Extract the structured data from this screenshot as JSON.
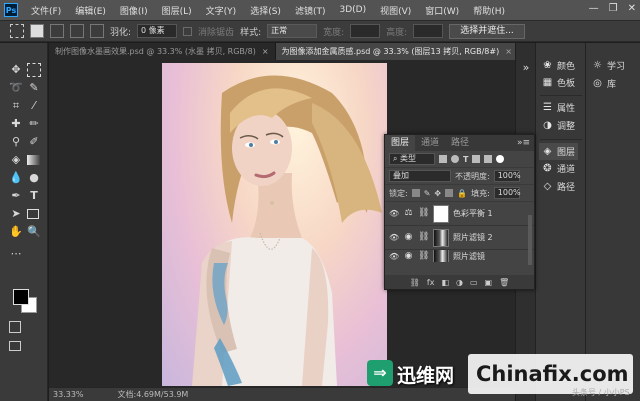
{
  "menubar": {
    "logo": "Ps",
    "items": [
      "文件(F)",
      "编辑(E)",
      "图像(I)",
      "图层(L)",
      "文字(Y)",
      "选择(S)",
      "滤镜(T)",
      "3D(D)",
      "视图(V)",
      "窗口(W)",
      "帮助(H)"
    ],
    "window_controls": [
      "—",
      "❐",
      "✕"
    ]
  },
  "options": {
    "feather_label": "羽化:",
    "feather_value": "0 像素",
    "antialias_label": "消除锯齿",
    "style_label": "样式:",
    "style_value": "正常",
    "width_label": "宽度:",
    "height_label": "高度:",
    "select_mask_button": "选择并遮住..."
  },
  "tabs": [
    {
      "label": "制作图像水墨画效果.psd @ 33.3% (水墨 拷贝, RGB/8)",
      "active": false
    },
    {
      "label": "为图像添加金属质感.psd @ 33.3% (图层13 拷贝, RGB/8#)",
      "active": true
    }
  ],
  "status": {
    "zoom": "33.33%",
    "doc": "文档:4.69M/53.9M"
  },
  "dock1": {
    "items": [
      "颜色",
      "色板",
      "属性",
      "调整",
      "图层",
      "通道",
      "路径"
    ]
  },
  "dock2": {
    "items": [
      "学习",
      "库"
    ]
  },
  "layers_panel": {
    "tabs": [
      "图层",
      "通道",
      "路径"
    ],
    "filter_label": "类型",
    "blend_mode": "叠加",
    "opacity_label": "不透明度:",
    "opacity_value": "100%",
    "lock_label": "锁定:",
    "fill_label": "填充:",
    "fill_value": "100%",
    "layers": [
      {
        "name": "色彩平衡 1"
      },
      {
        "name": "照片滤镜 2"
      },
      {
        "name": "照片滤镜"
      }
    ],
    "footer_icons": [
      "⛓",
      "fx",
      "◧",
      "◑",
      "▭",
      "▣",
      "🗑"
    ]
  },
  "watermarks": {
    "badge": "⇒",
    "chinese": "迅维网",
    "domain": "Chinafix.com",
    "small": "头条号 / 小小PS"
  }
}
